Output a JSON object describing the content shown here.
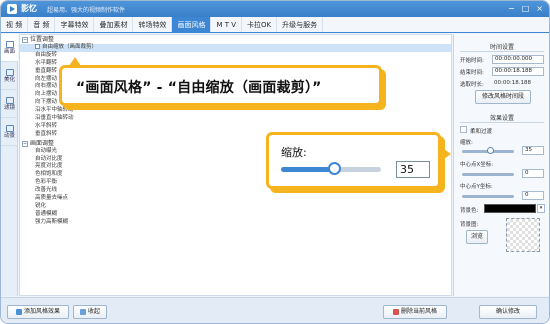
{
  "app": {
    "name": "影忆",
    "slogan": "超易用、强大的视频制作软件",
    "window_controls": [
      "−",
      "□",
      "×"
    ]
  },
  "tabs": [
    "视 频",
    "音 频",
    "字幕特效",
    "叠加素材",
    "转场特效",
    "画面风格",
    "M T V",
    "卡拉OK",
    "升级与服务"
  ],
  "active_tab": "画面风格",
  "left_nav": [
    {
      "label": "画面",
      "icon": "picture-icon"
    },
    {
      "label": "美化",
      "icon": "beautify-icon"
    },
    {
      "label": "滤镜",
      "icon": "filter-icon"
    },
    {
      "label": "动景",
      "icon": "motion-icon"
    }
  ],
  "effects": {
    "groups": [
      {
        "title": "位置调整",
        "items": [
          "自由缩放（画面裁剪）",
          "自由旋转",
          "水平翻转",
          "垂直翻转",
          "向左摆动",
          "向右摆动",
          "向上摆动",
          "向下摆动",
          "沿水平中轴转动",
          "沿垂直中轴转动",
          "水平斜转",
          "垂直斜转"
        ]
      },
      {
        "title": "画面调整",
        "items": [
          "自动曝光",
          "自动对比度",
          "亮度对比度",
          "色相饱和度",
          "色彩平衡",
          "改善光线",
          "高质量去噪点",
          "锐化",
          "普通模糊",
          "强力高斯模糊"
        ]
      }
    ],
    "selected": "自由缩放（画面裁剪）"
  },
  "bottom_buttons": {
    "add": "添加风格效果",
    "favorite": "收起",
    "delete": "删除当前风格",
    "confirm": "确认修改"
  },
  "time_settings": {
    "title": "时间设置",
    "start_label": "开始时间:",
    "start_value": "00:00:00.000",
    "end_label": "结束时间:",
    "end_value": "00:00:18.188",
    "duration_label": "选取时长:",
    "duration_value": "00:00:18.188",
    "modify_button": "修改风格时间段"
  },
  "effect_settings": {
    "title": "效果设置",
    "soft_transition_label": "柔和过渡",
    "soft_transition_checked": false,
    "zoom_label": "缩放:",
    "zoom_value": "35",
    "center_x_label": "中心点X坐标:",
    "center_x_value": "0",
    "center_y_label": "中心点Y坐标:",
    "center_y_value": "0",
    "bg_color_label": "背景色:",
    "bg_image_label": "背景图:",
    "browse_button": "浏览"
  },
  "callouts": {
    "path_text": "“画面风格” - “自由缩放（画面裁剪）”",
    "zoom_label": "缩放:",
    "zoom_value": "35",
    "zoom_fraction": 0.53
  },
  "colors": {
    "accent": "#3d86d3",
    "callout_border": "#f5b31e",
    "title_bar": "#4f95da"
  }
}
